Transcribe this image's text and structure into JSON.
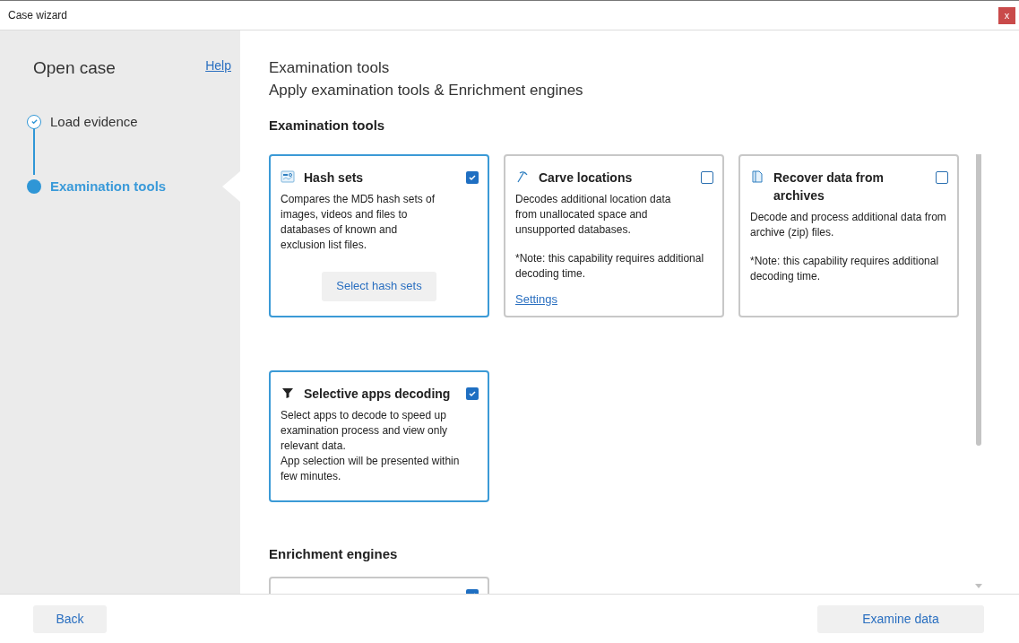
{
  "window": {
    "title": "Case wizard",
    "close": "x"
  },
  "sidebar": {
    "title": "Open case",
    "help": "Help",
    "steps": [
      {
        "label": "Load evidence",
        "completed": true,
        "selected": false
      },
      {
        "label": "Examination tools",
        "completed": false,
        "selected": true
      }
    ]
  },
  "header": {
    "title": "Examination tools",
    "subtitle": "Apply examination tools & Enrichment engines"
  },
  "examination_tools": {
    "title": "Examination tools",
    "cards": [
      {
        "title": "Hash sets",
        "checked": true,
        "description": "Compares the MD5 hash sets of images, videos and files to databases of known and exclusion list files.",
        "button": "Select hash sets"
      },
      {
        "title": "Carve locations",
        "checked": false,
        "description": "Decodes additional location data from unallocated space and unsupported databases.",
        "note": "*Note: this capability requires additional decoding time.",
        "link": "Settings"
      },
      {
        "title": "Recover data from archives",
        "checked": false,
        "description": "Decode and process additional data from archive (zip) files.",
        "note": "*Note: this capability requires additional decoding time."
      },
      {
        "title": "Selective apps decoding",
        "checked": true,
        "description": "Select apps to decode to speed up examination process and view only relevant data.\nApp selection will be presented within few minutes."
      }
    ]
  },
  "enrichment_engines": {
    "title": "Enrichment engines",
    "cards": [
      {
        "checked": true
      }
    ]
  },
  "footer": {
    "back": "Back",
    "next": "Examine data"
  }
}
